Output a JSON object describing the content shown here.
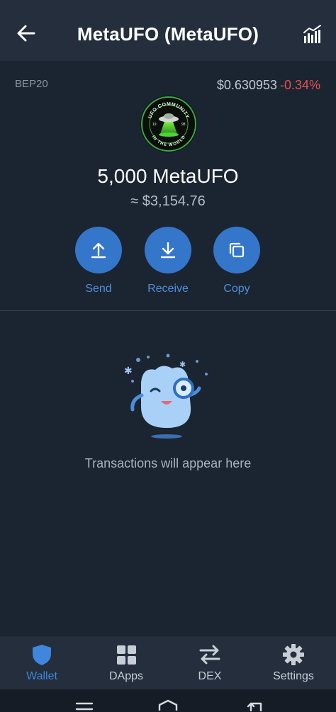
{
  "appbar": {
    "title": "MetaUFO (MetaUFO)",
    "back_icon": "arrow-left-icon",
    "chart_icon": "chart-icon"
  },
  "token": {
    "network": "BEP20",
    "price": "$0.630953",
    "change": "-0.34%",
    "logo_text_top": "UFO COMMUNITY",
    "logo_text_bottom": "IN THE WORLD",
    "logo_num_left": "19",
    "logo_num_right": "98",
    "balance": "5,000 MetaUFO",
    "fiat_balance": "≈ $3,154.76"
  },
  "actions": [
    {
      "label": "Send",
      "icon": "arrow-up-icon"
    },
    {
      "label": "Receive",
      "icon": "arrow-down-icon"
    },
    {
      "label": "Copy",
      "icon": "copy-icon"
    }
  ],
  "empty_state": {
    "text": "Transactions will appear here"
  },
  "bottom_nav": [
    {
      "label": "Wallet",
      "icon": "shield-icon",
      "active": true
    },
    {
      "label": "DApps",
      "icon": "grid-icon",
      "active": false
    },
    {
      "label": "DEX",
      "icon": "swap-icon",
      "active": false
    },
    {
      "label": "Settings",
      "icon": "gear-icon",
      "active": false
    }
  ],
  "colors": {
    "background": "#1b2431",
    "bar": "#242e3c",
    "accent": "#3476c9",
    "negative": "#e0534f"
  }
}
